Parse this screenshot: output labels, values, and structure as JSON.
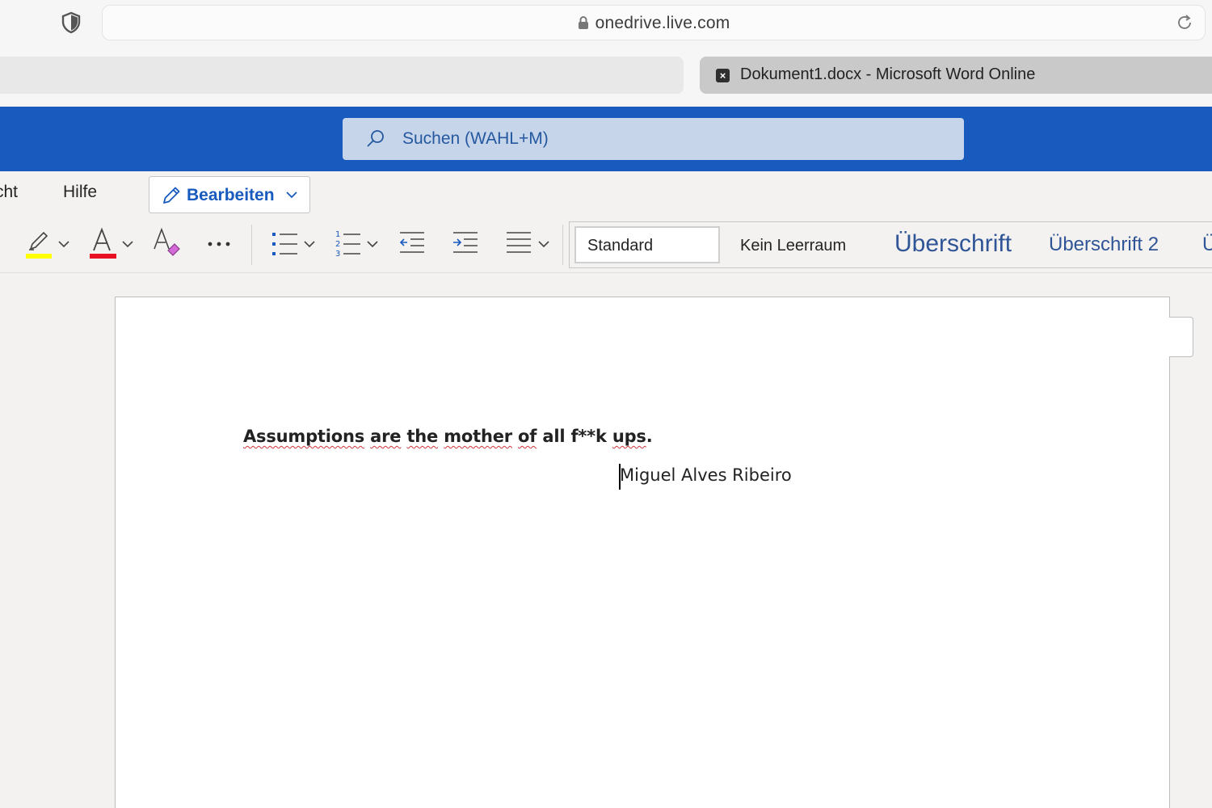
{
  "browser": {
    "url": "onedrive.live.com",
    "active_tab_title": "Dokument1.docx - Microsoft Word Online"
  },
  "word": {
    "search_placeholder": "Suchen (WAHL+M)",
    "menu_tabs": [
      "cht",
      "Hilfe"
    ],
    "edit_button_label": "Bearbeiten",
    "styles": [
      "Standard",
      "Kein Leerraum",
      "Überschrift",
      "Überschrift 2",
      "Ü"
    ],
    "colors": {
      "header_blue": "#185abd",
      "highlight": "#ffff00",
      "font_color": "#e81123"
    }
  },
  "document": {
    "quote_words": [
      "Assumptions",
      "are",
      "the",
      "mother",
      "of",
      "all",
      "f**k",
      "ups",
      "."
    ],
    "author": "Miguel Alves Ribeiro"
  }
}
